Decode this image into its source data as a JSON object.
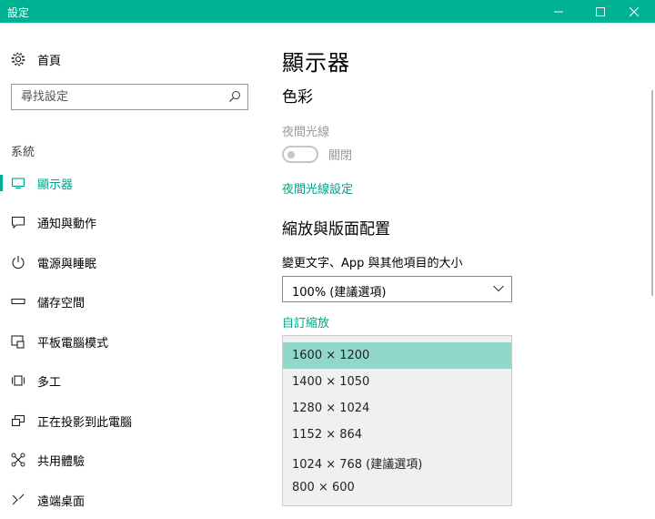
{
  "window": {
    "title": "設定"
  },
  "sidebar": {
    "home_label": "首頁",
    "search_placeholder": "尋找設定",
    "group_label": "系統",
    "items": [
      {
        "label": "顯示器",
        "icon": "monitor-icon",
        "active": true
      },
      {
        "label": "通知與動作",
        "icon": "notification-icon",
        "active": false
      },
      {
        "label": "電源與睡眠",
        "icon": "power-icon",
        "active": false
      },
      {
        "label": "儲存空間",
        "icon": "storage-icon",
        "active": false
      },
      {
        "label": "平板電腦模式",
        "icon": "tablet-mode-icon",
        "active": false
      },
      {
        "label": "多工",
        "icon": "multitasking-icon",
        "active": false
      },
      {
        "label": "正在投影到此電腦",
        "icon": "projecting-icon",
        "active": false
      },
      {
        "label": "共用體驗",
        "icon": "shared-experiences-icon",
        "active": false
      },
      {
        "label": "遠端桌面",
        "icon": "remote-desktop-icon",
        "active": false
      }
    ]
  },
  "main": {
    "page_title": "顯示器",
    "color_section": "色彩",
    "night_light_label": "夜間光線",
    "night_light_state": "關閉",
    "night_light_link": "夜間光線設定",
    "scale_section": "縮放與版面配置",
    "scale_label": "變更文字、App 與其他項目的大小",
    "scale_value": "100% (建議選項)",
    "custom_scaling_link": "自訂縮放",
    "resolution_options": [
      "1600 × 1200",
      "1400 × 1050",
      "1280 × 1024",
      "1152 × 864",
      "1024 × 768 (建議選項)",
      "800 × 600"
    ],
    "selected_resolution_index": 0
  },
  "colors": {
    "accent": "#00b294",
    "link": "#00a388",
    "highlight": "#91d8cb"
  }
}
